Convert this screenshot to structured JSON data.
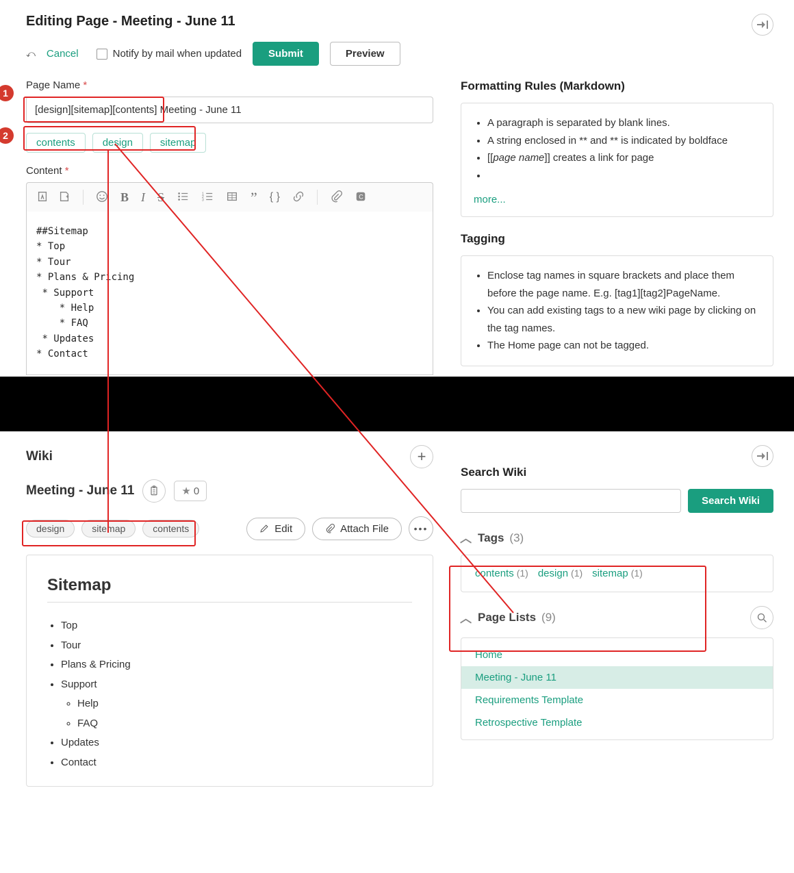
{
  "edit": {
    "title": "Editing Page - Meeting - June 11",
    "cancel": "Cancel",
    "notify_label": "Notify by mail when updated",
    "submit": "Submit",
    "preview": "Preview",
    "page_name_label": "Page Name",
    "page_name_value": "[design][sitemap][contents] Meeting - June 11",
    "tags": [
      "contents",
      "design",
      "sitemap"
    ],
    "content_label": "Content",
    "content_text": "##Sitemap\n* Top\n* Tour\n* Plans & Pricing\n * Support\n    * Help\n    * FAQ\n * Updates\n* Contact"
  },
  "sidebar_edit": {
    "formatting_title": "Formatting Rules (Markdown)",
    "formatting_rules": [
      "A paragraph is separated by blank lines.",
      "A string enclosed in ** and ** is indicated by boldface",
      "[[page name]] creates a link for page",
      ""
    ],
    "more": "more...",
    "tagging_title": "Tagging",
    "tagging_rules": [
      "Enclose tag names in square brackets and place them before the page name. E.g. [tag1][tag2]PageName.",
      "You can add existing tags to a new wiki page by clicking on the tag names.",
      "The Home page can not be tagged."
    ]
  },
  "view": {
    "section": "Wiki",
    "title": "Meeting - June 11",
    "star_count": "0",
    "tags": [
      "design",
      "sitemap",
      "contents"
    ],
    "edit_btn": "Edit",
    "attach_btn": "Attach File",
    "heading": "Sitemap",
    "items": [
      {
        "t": "Top"
      },
      {
        "t": "Tour"
      },
      {
        "t": "Plans & Pricing"
      },
      {
        "t": "Support",
        "children": [
          "Help",
          "FAQ"
        ]
      },
      {
        "t": "Updates"
      },
      {
        "t": "Contact"
      }
    ]
  },
  "sidebar_view": {
    "search_label": "Search Wiki",
    "search_btn": "Search Wiki",
    "tags_label": "Tags",
    "tags_count": "(3)",
    "tag_list": [
      {
        "name": "contents",
        "count": "(1)"
      },
      {
        "name": "design",
        "count": "(1)"
      },
      {
        "name": "sitemap",
        "count": "(1)"
      }
    ],
    "pagelists_label": "Page Lists",
    "pagelists_count": "(9)",
    "pages": [
      "Home",
      "Meeting - June 11",
      "Requirements Template",
      "Retrospective Template"
    ],
    "active_page": "Meeting - June 11"
  },
  "annotations": {
    "1": "1",
    "2": "2"
  }
}
